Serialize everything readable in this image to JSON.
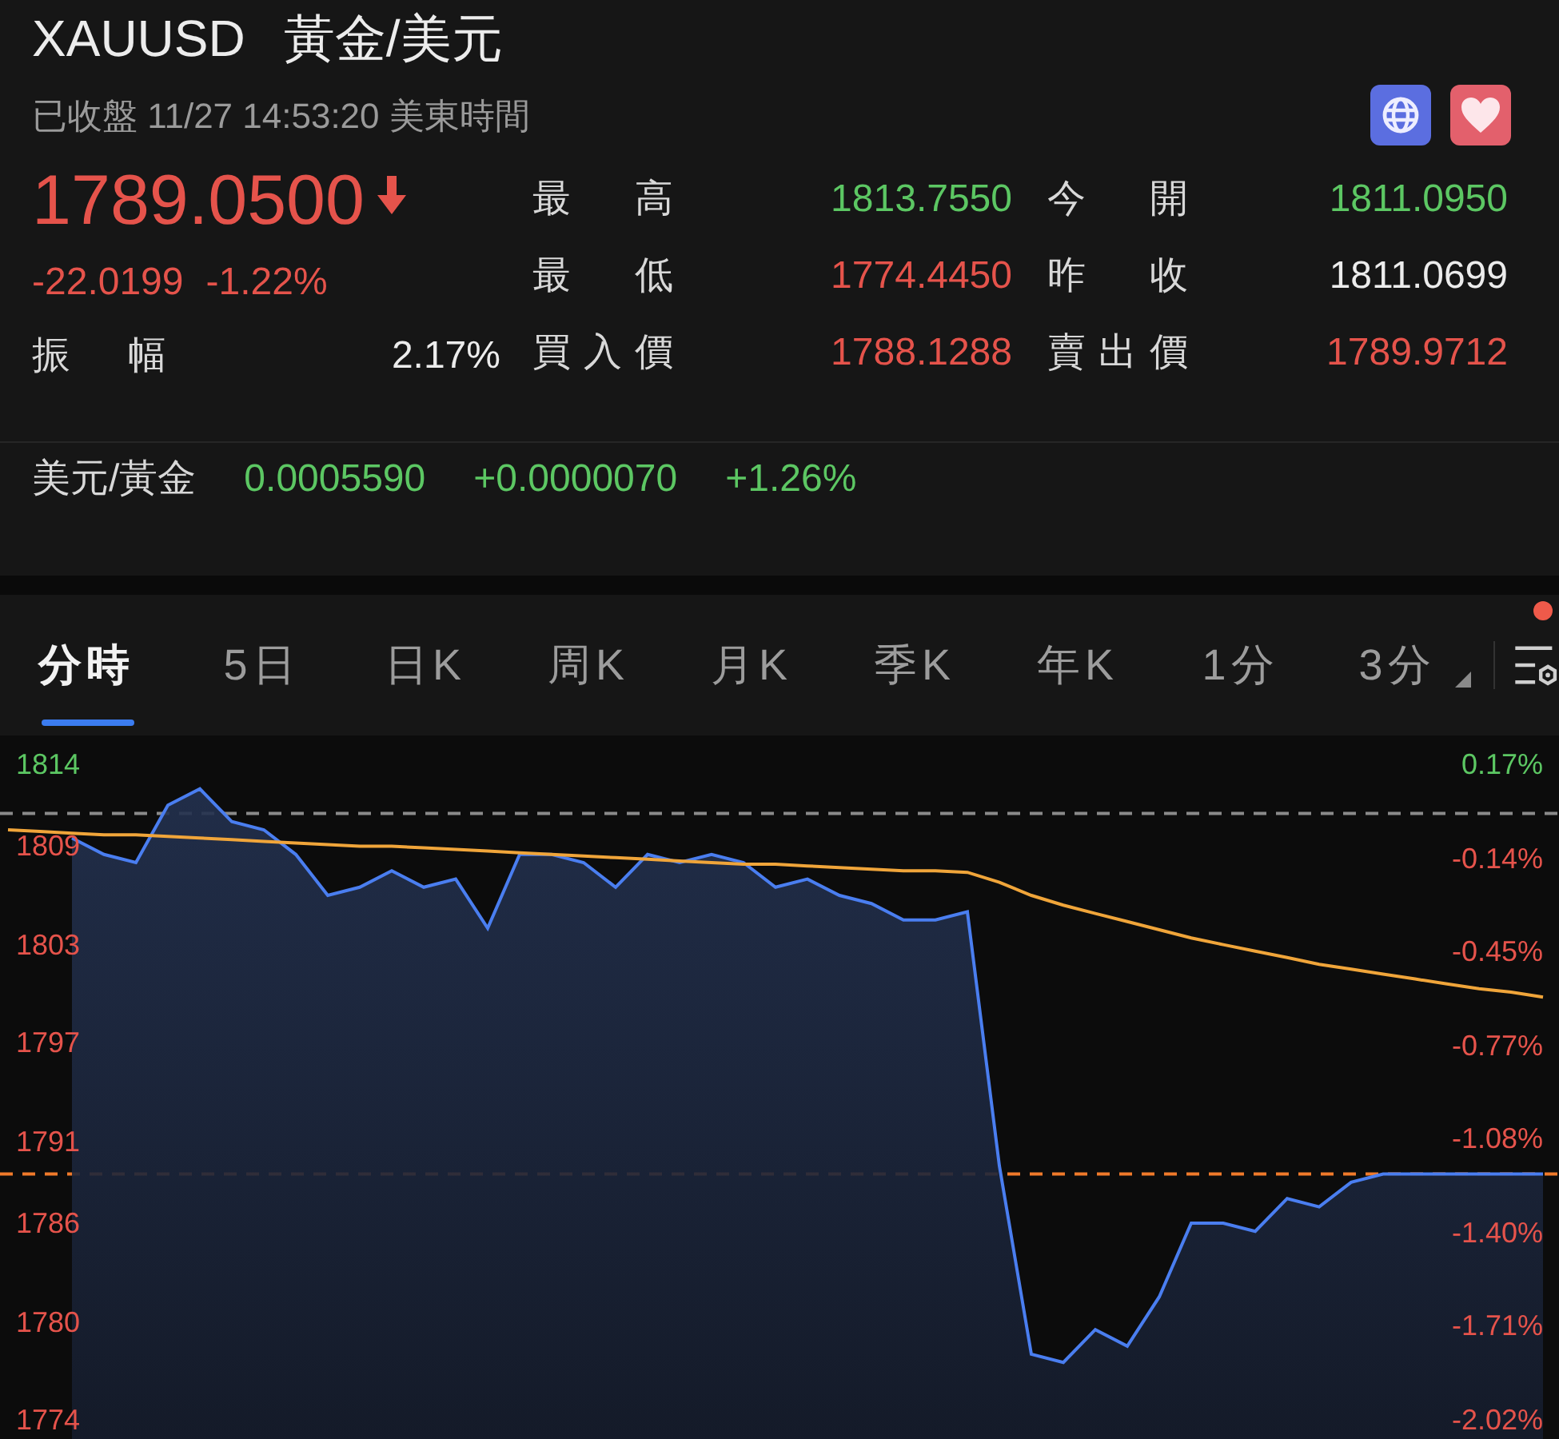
{
  "header": {
    "symbol": "XAUUSD",
    "name": "黃金/美元",
    "status": "已收盤 11/27 14:53:20 美東時間"
  },
  "actions": [
    {
      "kind": "globe"
    },
    {
      "kind": "heart"
    }
  ],
  "quote": {
    "price": "1789.0500",
    "falling": true,
    "change": "-22.0199",
    "change_percent": "-1.22%",
    "amplitude_label": "振幅",
    "amplitude": "2.17%"
  },
  "stats": [
    {
      "label": "最高",
      "value": "1813.7550",
      "color": "#5cc763"
    },
    {
      "label": "今開",
      "value": "1811.0950",
      "color": "#5cc763"
    },
    {
      "label": "最低",
      "value": "1774.4450",
      "color": "#e5534b"
    },
    {
      "label": "昨收",
      "value": "1811.0699",
      "color": "#ececec"
    },
    {
      "label": "買入價",
      "value": "1788.1288",
      "color": "#e5534b"
    },
    {
      "label": "賣出價",
      "value": "1789.9712",
      "color": "#e5534b"
    }
  ],
  "cross_rate": {
    "label": "美元/黃金",
    "value": "0.0005590",
    "change": "+0.0000070",
    "change_percent": "+1.26%",
    "color": "#5cc763"
  },
  "tabs": [
    {
      "label": "分時",
      "selected": true
    },
    {
      "label": "5日",
      "selected": false
    },
    {
      "label": "日K",
      "selected": false
    },
    {
      "label": "周K",
      "selected": false
    },
    {
      "label": "月K",
      "selected": false
    },
    {
      "label": "季K",
      "selected": false
    },
    {
      "label": "年K",
      "selected": false
    },
    {
      "label": "1分",
      "selected": false
    },
    {
      "label": "3分",
      "selected": false,
      "has_menu": true
    }
  ],
  "settings_badge": true,
  "chart": {
    "chart_data": {
      "type": "line",
      "ylim": [
        1774,
        1814
      ],
      "yticks": [
        1814,
        1809,
        1803,
        1797,
        1791,
        1786,
        1780,
        1774
      ],
      "series": [
        {
          "type": "area",
          "color": "#4a7ef0",
          "values": [
            null,
            null,
            1809.5,
            1808.5,
            1808,
            1811.5,
            1812.5,
            1810.5,
            1810,
            1808.5,
            1806,
            1806.5,
            1807.5,
            1806.5,
            1807,
            1804,
            1808.5,
            1808.5,
            1808,
            1806.5,
            1808.5,
            1808,
            1808.5,
            1808,
            1806.5,
            1807,
            1806,
            1805.5,
            1804.5,
            1804.5,
            1805,
            1789.5,
            1778,
            1777.5,
            1779.5,
            1778.5,
            1781.5,
            1786,
            1786,
            1785.5,
            1787.5,
            1787,
            1788.5,
            1789,
            1789,
            1789,
            1789,
            1789,
            1789
          ]
        },
        {
          "color": "#f0a53a",
          "values": [
            1810,
            1809.9,
            1809.8,
            1809.7,
            1809.7,
            1809.6,
            1809.5,
            1809.4,
            1809.3,
            1809.2,
            1809.1,
            1809,
            1809,
            1808.9,
            1808.8,
            1808.7,
            1808.6,
            1808.5,
            1808.4,
            1808.3,
            1808.2,
            1808.1,
            1808,
            1807.9,
            1807.9,
            1807.8,
            1807.7,
            1807.6,
            1807.5,
            1807.5,
            1807.4,
            1806.8,
            1806,
            1805.4,
            1804.9,
            1804.4,
            1803.9,
            1803.4,
            1803,
            1802.6,
            1802.2,
            1801.8,
            1801.5,
            1801.2,
            1800.9,
            1800.6,
            1800.3,
            1800.1,
            1799.8
          ]
        }
      ],
      "ref_lines": [
        {
          "axis": "y",
          "value": 1811,
          "color": "#8a8a8a"
        },
        {
          "axis": "y",
          "value": 1789,
          "color": "#f07a2a"
        }
      ]
    },
    "right_axis": [
      {
        "label": "0.17%",
        "color": "#5cc763"
      },
      {
        "label": "-0.14%",
        "color": "#e5534b"
      },
      {
        "label": "-0.45%",
        "color": "#e5534b"
      },
      {
        "label": "-0.77%",
        "color": "#e5534b"
      },
      {
        "label": "-1.08%",
        "color": "#e5534b"
      },
      {
        "label": "-1.40%",
        "color": "#e5534b"
      },
      {
        "label": "-1.71%",
        "color": "#e5534b"
      },
      {
        "label": "-2.02%",
        "color": "#e5534b"
      }
    ]
  }
}
